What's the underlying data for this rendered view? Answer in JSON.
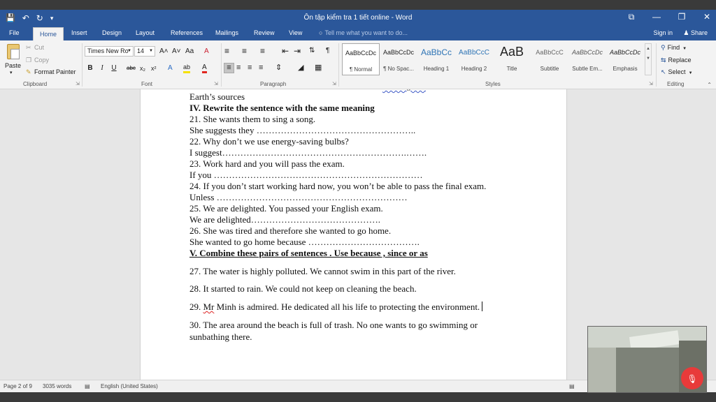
{
  "window": {
    "title": "Ôn tập kiểm tra 1 tiết online - Word",
    "controls": [
      "⧉",
      "—",
      "❐",
      "✕"
    ]
  },
  "qat": {
    "save_icon": "💾",
    "undo_icon": "↶",
    "redo_icon": "↻",
    "customize_icon": "▾"
  },
  "tabs": [
    "File",
    "Home",
    "Insert",
    "Design",
    "Layout",
    "References",
    "Mailings",
    "Review",
    "View"
  ],
  "active_tab": "Home",
  "tell_me": "Tell me what you want to do...",
  "account": {
    "sign_in": "Sign in",
    "share": "Share"
  },
  "clipboard": {
    "paste": "Paste",
    "cut": "Cut",
    "copy": "Copy",
    "format_painter": "Format Painter",
    "label": "Clipboard"
  },
  "font": {
    "name": "Times New Ro",
    "size": "14",
    "grow": "A˄",
    "shrink": "A˅",
    "case": "Aa",
    "clear": "A",
    "bold": "B",
    "italic": "I",
    "underline": "U",
    "strike": "abc",
    "subscript": "x₂",
    "superscript": "x²",
    "effects": "A",
    "highlight": "ab",
    "color": "A",
    "label": "Font"
  },
  "paragraph": {
    "label": "Paragraph",
    "show_marks": "¶",
    "sort": "⇅"
  },
  "styles": {
    "label": "Styles",
    "items": [
      {
        "sample": "AaBbCcDc",
        "name": "¶ Normal"
      },
      {
        "sample": "AaBbCcDc",
        "name": "¶ No Spac..."
      },
      {
        "sample": "AaBbCc",
        "name": "Heading 1"
      },
      {
        "sample": "AaBbCcC",
        "name": "Heading 2"
      },
      {
        "sample": "AaB",
        "name": "Title"
      },
      {
        "sample": "AaBbCcC",
        "name": "Subtitle"
      },
      {
        "sample": "AaBbCcDc",
        "name": "Subtle Em..."
      },
      {
        "sample": "AaBbCcDc",
        "name": "Emphasis"
      }
    ],
    "selected_index": 0
  },
  "editing": {
    "label": "Editing",
    "find": "Find",
    "replace": "Replace",
    "select": "Select"
  },
  "document": {
    "lines": [
      "Earth’s sources",
      "IV. Rewrite the sentence with the same meaning",
      "21. She wants them to sing a song.",
      "She suggests they ……………………………………………..",
      "22. Why don’t we use energy-saving bulbs?",
      "I suggest…………………………………………………….…….",
      "23. Work hard and you will pass the exam.",
      "If you ……………………………………………………………",
      "24. If you don’t start working hard now, you won’t be able to pass the final exam.",
      "Unless ………………………………………………………",
      "25. We are delighted. You passed your English exam.",
      "We are delighted…………………………………….",
      "26. She was tired and therefore she wanted to go home.",
      "She wanted to go home because ……………………………….",
      "V. Combine these pairs of sentences . Use because , since or as",
      "27. The water is highly polluted. We cannot swim in this part of the river.",
      "28. It started to rain. We could not keep on cleaning the beach.",
      "29.",
      "Mr",
      " Minh is admired. He dedicated all his life to protecting the environment.",
      "30. The area around the beach is full of trash. No one wants to go swimming or",
      "sunbathing there.",
      "….."
    ]
  },
  "status": {
    "page": "Page 2 of 9",
    "words": "3035 words",
    "language": "English (United States)"
  },
  "mic_icon": "🎙"
}
